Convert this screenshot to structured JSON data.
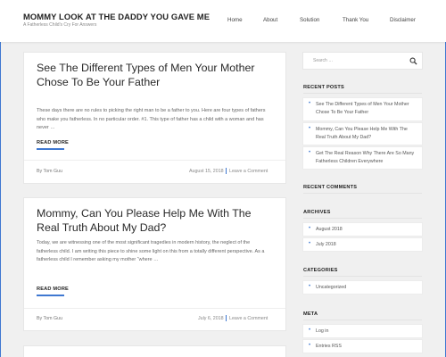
{
  "site": {
    "title": "MOMMY LOOK AT THE DADDY YOU GAVE ME",
    "tagline": "A Fatherless Child's Cry For Answers"
  },
  "nav": {
    "items": [
      {
        "label": "Home"
      },
      {
        "label": "About"
      },
      {
        "label": "Solution"
      },
      {
        "label": "Thank You"
      },
      {
        "label": "Disclaimer"
      }
    ]
  },
  "posts": [
    {
      "title": "See The Different Types of Men Your Mother Chose To Be Your Father",
      "excerpt": "These days there are no rules to picking the right man to be a father to you. Here are four types of fathers who make you fatherless. In no particular order. #1. This type of father has a child with a woman and has never …",
      "read_more": "READ MORE",
      "author": "By Tom Guu",
      "date": "August 15, 2018",
      "comment": "Leave a Comment"
    },
    {
      "title": "Mommy, Can You Please Help Me With The Real Truth About My Dad?",
      "excerpt": "Today, we are witnessing one of the most significant tragedies in modern history, the neglect of the fatherless child. I am writing this piece to shine some light on this from a totally different perspective.  As a fatherless child I remember asking my mother “where …",
      "read_more": "READ MORE",
      "author": "By Tom Guu",
      "date": "July 6, 2018",
      "comment": "Leave a Comment"
    }
  ],
  "sidebar": {
    "search_placeholder": "Search …",
    "recent_posts_title": "RECENT POSTS",
    "recent_posts": [
      {
        "label": "See The Different Types of Men Your Mother Chose To Be Your Father"
      },
      {
        "label": "Mommy, Can You Please Help Me With The Real Truth About My Dad?"
      },
      {
        "label": "Get The Real Reason Why There Are So Many Fatherless Children Everywhere"
      }
    ],
    "recent_comments_title": "RECENT COMMENTS",
    "archives_title": "ARCHIVES",
    "archives": [
      {
        "label": "August 2018"
      },
      {
        "label": "July 2018"
      }
    ],
    "categories_title": "CATEGORIES",
    "categories": [
      {
        "label": "Uncategorized"
      }
    ],
    "meta_title": "META",
    "meta": [
      {
        "label": "Log in"
      },
      {
        "label": "Entries RSS"
      }
    ]
  },
  "colors": {
    "accent": "#3f78d1",
    "background": "#f0f0f0",
    "card": "#ffffff"
  }
}
